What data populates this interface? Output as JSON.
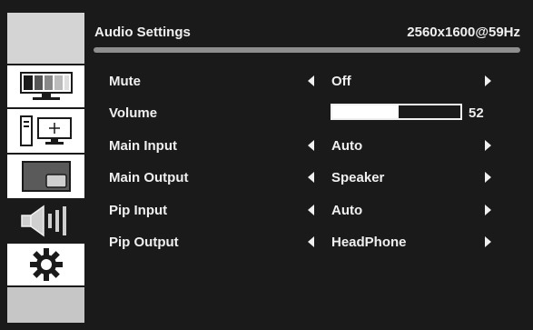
{
  "header": {
    "title": "Audio Settings",
    "resolution": "2560x1600@59Hz"
  },
  "sidebar": {
    "items": [
      {
        "name": "brightness-tab",
        "icon": "monitor-bars-icon"
      },
      {
        "name": "display-tab",
        "icon": "pc-monitor-icon"
      },
      {
        "name": "pip-tab",
        "icon": "picture-in-picture-icon"
      },
      {
        "name": "audio-tab",
        "icon": "speaker-icon",
        "active": true
      },
      {
        "name": "settings-tab",
        "icon": "gear-icon"
      }
    ]
  },
  "settings": {
    "mute": {
      "label": "Mute",
      "value": "Off"
    },
    "volume": {
      "label": "Volume",
      "value": "52",
      "level": 0.52
    },
    "main_input": {
      "label": "Main Input",
      "value": "Auto"
    },
    "main_output": {
      "label": "Main Output",
      "value": "Speaker"
    },
    "pip_input": {
      "label": "Pip Input",
      "value": "Auto"
    },
    "pip_output": {
      "label": "Pip Output",
      "value": "HeadPhone"
    }
  },
  "colors": {
    "background": "#1a1a1a",
    "text": "#f0f0f0",
    "sidebar": "#cfcfcf"
  }
}
